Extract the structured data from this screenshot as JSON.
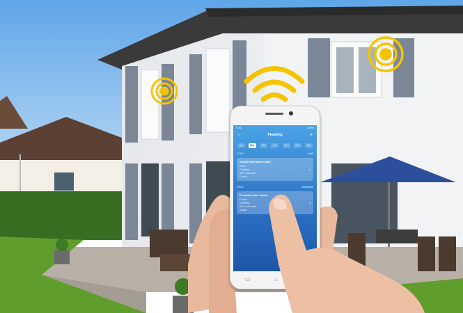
{
  "app": {
    "status_time": "9:41",
    "status_battery": "100%",
    "back_icon": "chevron-left-icon",
    "title": "Planning",
    "add_icon": "plus-icon"
  },
  "days": [
    "Lun",
    "Mar",
    "Mer",
    "Jeu",
    "Ven",
    "Sam",
    "Dim"
  ],
  "active_day_index": 1,
  "schedules": [
    {
      "time": "07:00",
      "state": "Actif",
      "card_title": "Grand froid sans volets",
      "lines": [
        "Ouvrir",
        "2 fenêtres",
        "Nord, sud-ouest",
        "Couloir"
      ]
    },
    {
      "time": "19:00",
      "state": "Désactivé",
      "card_title": "Fermeture des volets",
      "lines": [
        "Fermer",
        "4 fenêtres",
        "Nord, sud-ouest",
        "Couloir"
      ]
    }
  ],
  "nav_icons": [
    "menu-icon",
    "home-icon",
    "back-arrow-icon"
  ],
  "colors": {
    "sky": "#9ec9f0",
    "wall": "#eef0f3",
    "shutter": "#7b8796",
    "signal": "#f5c400",
    "screen": "#2f7ad1",
    "umbrella": "#2b4f9a",
    "lawn": "#5f9e2c"
  }
}
